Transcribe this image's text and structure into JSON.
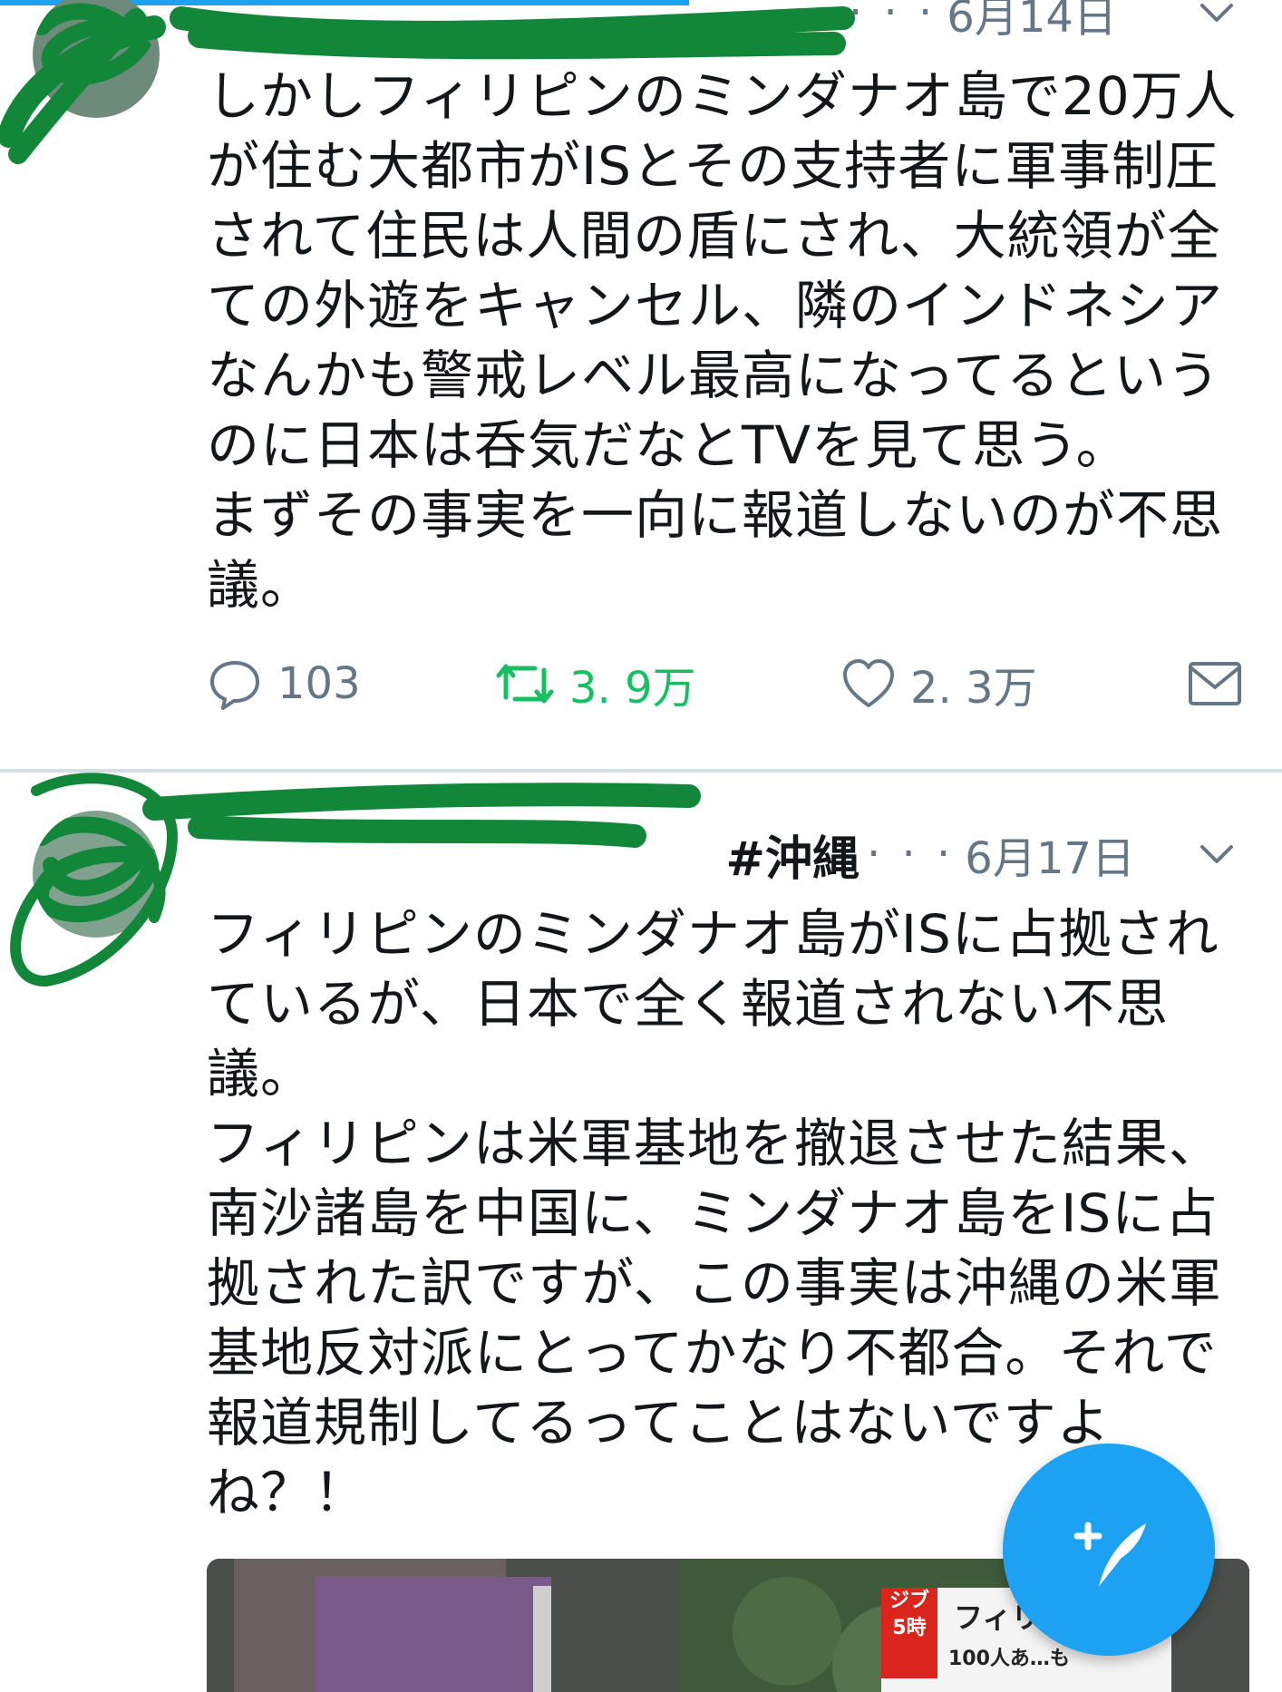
{
  "tweets": [
    {
      "author": "",
      "date": "6月14日",
      "text": "しかしフィリピンのミンダナオ島で20万人\nが住む大都市がISとその支持者に軍事制圧\nされて住民は人間の盾にされ、大統領が全\nての外遊をキャンセル、隣のインドネシア\nなんかも警戒レベル最高になってるという\nのに日本は呑気だなとTVを見て思う。\nまずその事実を一向に報道しないのが不思\n議。",
      "replies": "103",
      "retweets": "3. 9万",
      "likes": "2. 3万"
    },
    {
      "author": "#沖縄",
      "date": "6月17日",
      "text": "フィリピンのミンダナオ島がISに占拠され\nているが、日本で全く報道されない不思\n議。\nフィリピンは米軍基地を撤退させた結果、\n南沙諸島を中国に、ミンダナオ島をISに占\n拠された訳ですが、この事実は沖縄の米軍\n基地反対派にとってかなり不都合。それで\n報道規制してるってことはないですよ\nね？！",
      "media": {
        "badge_small": "ジブ 5時",
        "badge_line1": "フィリ",
        "badge_line2": "100人あ…も"
      }
    }
  ],
  "ellipsis": "· · ·",
  "icons": {
    "reply": "reply-icon",
    "retweet": "retweet-icon",
    "like": "heart-icon",
    "mail": "mail-icon",
    "menu": "chevron-down-icon",
    "compose": "compose-icon"
  },
  "colors": {
    "text": "#14171a",
    "muted": "#657786",
    "retweet": "#17bf63",
    "accent": "#1da1f2",
    "redaction": "#12873a"
  }
}
